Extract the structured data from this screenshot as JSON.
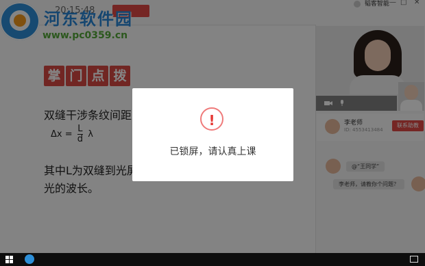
{
  "watermark": {
    "title": "河东软件园",
    "url": "www.pc0359.cn",
    "partial_top_left_text": "20:15:48"
  },
  "top_bar": {
    "user_label": "韬客智能",
    "window_controls": [
      "—",
      "□",
      "✕"
    ]
  },
  "slide": {
    "badge_chars": [
      "掌",
      "门",
      "点",
      "拨"
    ],
    "line1": "双缝干涉条纹间距",
    "formula": {
      "lhs": "Δx",
      "eq": "=",
      "num": "L",
      "den": "d",
      "rhs": "λ"
    },
    "line2": "其中L为双缝到光屏",
    "line3": "光的波长。"
  },
  "sidebar": {
    "teacher_name": "李老师",
    "teacher_id": "ID: 4553413484",
    "contact_button": "联系助教",
    "messages": [
      "@“王同学”",
      "李老师，请教你个问题？"
    ]
  },
  "modal": {
    "icon_glyph": "!",
    "message": "已锁屏，请认真上课"
  },
  "colors": {
    "accent_red": "#e04a46",
    "watermark_blue": "#2a86d6",
    "watermark_green": "#55a93a",
    "overlay": "rgba(0,0,0,0.48)",
    "taskbar": "#0e0e0e"
  },
  "icons": {
    "camera": "camera-icon",
    "mic": "mic-icon",
    "warning": "warning-icon",
    "windows": "windows-start-icon",
    "tray": "notification-icon"
  }
}
